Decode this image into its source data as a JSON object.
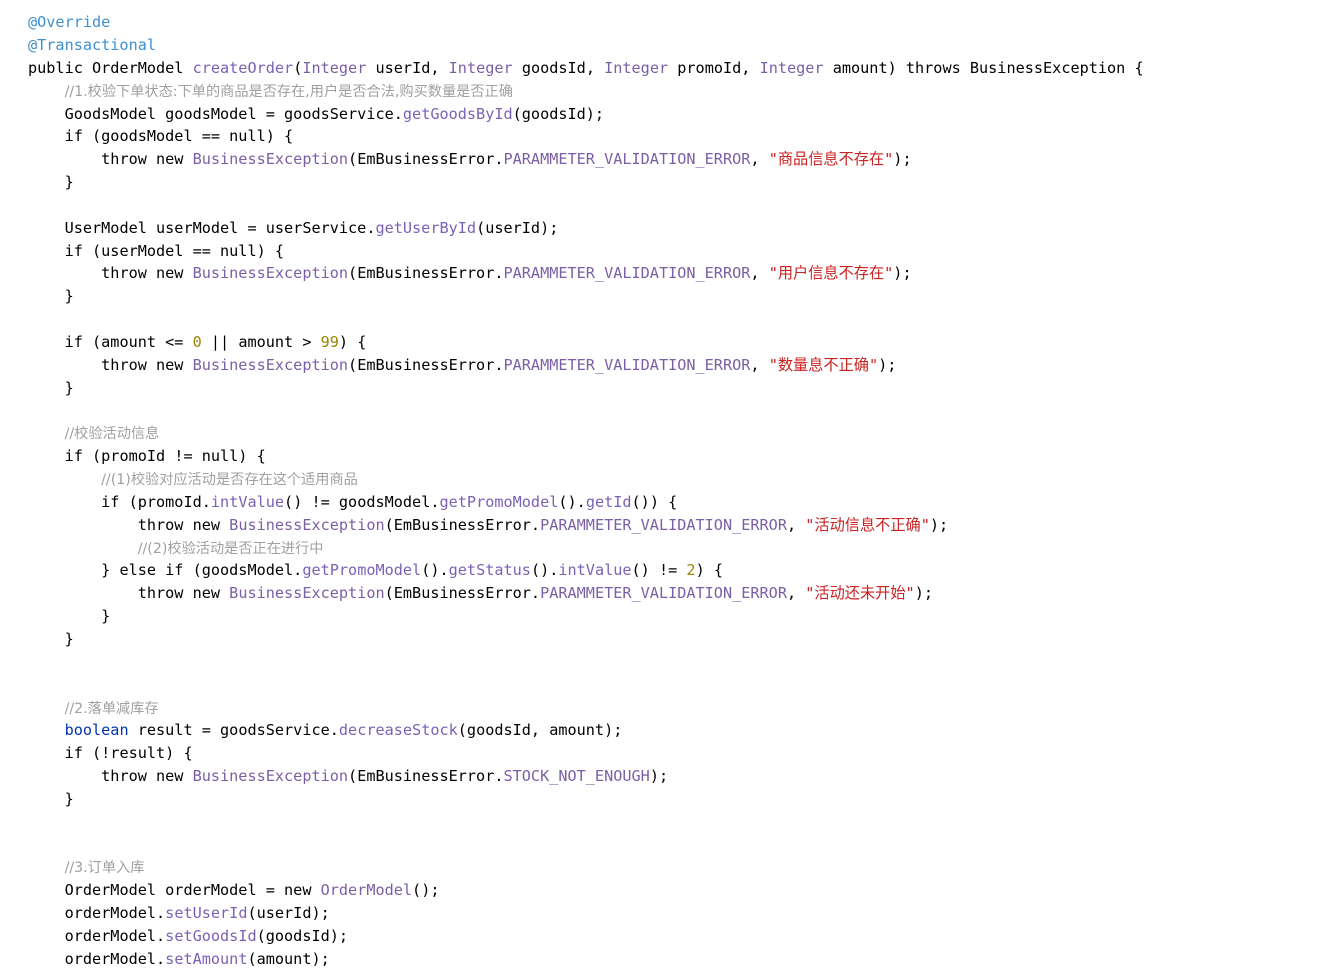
{
  "editor": {
    "language": "java",
    "background_color": "#ffffff",
    "default_text_color": "#000000",
    "font_size_px": 15,
    "line_height_px": 23,
    "visible_line_count": 41
  },
  "theme": {
    "annotation_color": "#3f8fcf",
    "keyword_color": "#0033b3",
    "class_type_color": "#7a5fa5",
    "method_call_color": "#7b61b5",
    "constant_color": "#7a5fa5",
    "string_color": "#cc2222",
    "number_color": "#9b8300",
    "comment_color": "#a0a0a0",
    "identifier_color": "#000000"
  },
  "code": {
    "lines": [
      {
        "n": 1,
        "indent": 0,
        "tokens": [
          {
            "t": "annotation",
            "v": "@Override"
          }
        ]
      },
      {
        "n": 2,
        "indent": 0,
        "tokens": [
          {
            "t": "annotation",
            "v": "@Transactional"
          }
        ]
      },
      {
        "n": 3,
        "indent": 0,
        "tokens": [
          {
            "t": "plain",
            "v": "public OrderModel "
          },
          {
            "t": "method",
            "v": "createOrder"
          },
          {
            "t": "plain",
            "v": "("
          },
          {
            "t": "type",
            "v": "Integer"
          },
          {
            "t": "plain",
            "v": " userId, "
          },
          {
            "t": "type",
            "v": "Integer"
          },
          {
            "t": "plain",
            "v": " goodsId, "
          },
          {
            "t": "type",
            "v": "Integer"
          },
          {
            "t": "plain",
            "v": " promoId, "
          },
          {
            "t": "type",
            "v": "Integer"
          },
          {
            "t": "plain",
            "v": " amount) throws BusinessException {"
          }
        ]
      },
      {
        "n": 4,
        "indent": 1,
        "tokens": [
          {
            "t": "comment",
            "v": "//1.校验下单状态:下单的商品是否存在,用户是否合法,购买数量是否正确"
          }
        ]
      },
      {
        "n": 5,
        "indent": 1,
        "tokens": [
          {
            "t": "plain",
            "v": "GoodsModel goodsModel = goodsService."
          },
          {
            "t": "method",
            "v": "getGoodsById"
          },
          {
            "t": "plain",
            "v": "(goodsId);"
          }
        ]
      },
      {
        "n": 6,
        "indent": 1,
        "tokens": [
          {
            "t": "plain",
            "v": "if (goodsModel == null) {"
          }
        ]
      },
      {
        "n": 7,
        "indent": 2,
        "tokens": [
          {
            "t": "plain",
            "v": "throw new "
          },
          {
            "t": "type",
            "v": "BusinessException"
          },
          {
            "t": "plain",
            "v": "(EmBusinessError."
          },
          {
            "t": "const",
            "v": "PARAMMETER_VALIDATION_ERROR"
          },
          {
            "t": "plain",
            "v": ", "
          },
          {
            "t": "string",
            "v": "\"商品信息不存在\""
          },
          {
            "t": "plain",
            "v": ");"
          }
        ]
      },
      {
        "n": 8,
        "indent": 1,
        "tokens": [
          {
            "t": "plain",
            "v": "}"
          }
        ]
      },
      {
        "n": 9,
        "indent": 0,
        "tokens": []
      },
      {
        "n": 10,
        "indent": 1,
        "tokens": [
          {
            "t": "plain",
            "v": "UserModel userModel = userService."
          },
          {
            "t": "method",
            "v": "getUserById"
          },
          {
            "t": "plain",
            "v": "(userId);"
          }
        ]
      },
      {
        "n": 11,
        "indent": 1,
        "tokens": [
          {
            "t": "plain",
            "v": "if (userModel == null) {"
          }
        ]
      },
      {
        "n": 12,
        "indent": 2,
        "tokens": [
          {
            "t": "plain",
            "v": "throw new "
          },
          {
            "t": "type",
            "v": "BusinessException"
          },
          {
            "t": "plain",
            "v": "(EmBusinessError."
          },
          {
            "t": "const",
            "v": "PARAMMETER_VALIDATION_ERROR"
          },
          {
            "t": "plain",
            "v": ", "
          },
          {
            "t": "string",
            "v": "\"用户信息不存在\""
          },
          {
            "t": "plain",
            "v": ");"
          }
        ]
      },
      {
        "n": 13,
        "indent": 1,
        "tokens": [
          {
            "t": "plain",
            "v": "}"
          }
        ]
      },
      {
        "n": 14,
        "indent": 0,
        "tokens": []
      },
      {
        "n": 15,
        "indent": 1,
        "tokens": [
          {
            "t": "plain",
            "v": "if (amount <= "
          },
          {
            "t": "number",
            "v": "0"
          },
          {
            "t": "plain",
            "v": " || amount > "
          },
          {
            "t": "number",
            "v": "99"
          },
          {
            "t": "plain",
            "v": ") {"
          }
        ]
      },
      {
        "n": 16,
        "indent": 2,
        "tokens": [
          {
            "t": "plain",
            "v": "throw new "
          },
          {
            "t": "type",
            "v": "BusinessException"
          },
          {
            "t": "plain",
            "v": "(EmBusinessError."
          },
          {
            "t": "const",
            "v": "PARAMMETER_VALIDATION_ERROR"
          },
          {
            "t": "plain",
            "v": ", "
          },
          {
            "t": "string",
            "v": "\"数量息不正确\""
          },
          {
            "t": "plain",
            "v": ");"
          }
        ]
      },
      {
        "n": 17,
        "indent": 1,
        "tokens": [
          {
            "t": "plain",
            "v": "}"
          }
        ]
      },
      {
        "n": 18,
        "indent": 0,
        "tokens": []
      },
      {
        "n": 19,
        "indent": 1,
        "tokens": [
          {
            "t": "comment",
            "v": "//校验活动信息"
          }
        ]
      },
      {
        "n": 20,
        "indent": 1,
        "tokens": [
          {
            "t": "plain",
            "v": "if (promoId != null) {"
          }
        ]
      },
      {
        "n": 21,
        "indent": 2,
        "tokens": [
          {
            "t": "comment",
            "v": "//(1)校验对应活动是否存在这个适用商品"
          }
        ]
      },
      {
        "n": 22,
        "indent": 2,
        "tokens": [
          {
            "t": "plain",
            "v": "if (promoId."
          },
          {
            "t": "method",
            "v": "intValue"
          },
          {
            "t": "plain",
            "v": "() != goodsModel."
          },
          {
            "t": "method",
            "v": "getPromoModel"
          },
          {
            "t": "plain",
            "v": "()."
          },
          {
            "t": "method",
            "v": "getId"
          },
          {
            "t": "plain",
            "v": "()) {"
          }
        ]
      },
      {
        "n": 23,
        "indent": 3,
        "tokens": [
          {
            "t": "plain",
            "v": "throw new "
          },
          {
            "t": "type",
            "v": "BusinessException"
          },
          {
            "t": "plain",
            "v": "(EmBusinessError."
          },
          {
            "t": "const",
            "v": "PARAMMETER_VALIDATION_ERROR"
          },
          {
            "t": "plain",
            "v": ", "
          },
          {
            "t": "string",
            "v": "\"活动信息不正确\""
          },
          {
            "t": "plain",
            "v": ");"
          }
        ]
      },
      {
        "n": 24,
        "indent": 3,
        "tokens": [
          {
            "t": "comment",
            "v": "//(2)校验活动是否正在进行中"
          }
        ]
      },
      {
        "n": 25,
        "indent": 2,
        "tokens": [
          {
            "t": "plain",
            "v": "} else if (goodsModel."
          },
          {
            "t": "method",
            "v": "getPromoModel"
          },
          {
            "t": "plain",
            "v": "()."
          },
          {
            "t": "method",
            "v": "getStatus"
          },
          {
            "t": "plain",
            "v": "()."
          },
          {
            "t": "method",
            "v": "intValue"
          },
          {
            "t": "plain",
            "v": "() != "
          },
          {
            "t": "number",
            "v": "2"
          },
          {
            "t": "plain",
            "v": ") {"
          }
        ]
      },
      {
        "n": 26,
        "indent": 3,
        "tokens": [
          {
            "t": "plain",
            "v": "throw new "
          },
          {
            "t": "type",
            "v": "BusinessException"
          },
          {
            "t": "plain",
            "v": "(EmBusinessError."
          },
          {
            "t": "const",
            "v": "PARAMMETER_VALIDATION_ERROR"
          },
          {
            "t": "plain",
            "v": ", "
          },
          {
            "t": "string",
            "v": "\"活动还未开始\""
          },
          {
            "t": "plain",
            "v": ");"
          }
        ]
      },
      {
        "n": 27,
        "indent": 2,
        "tokens": [
          {
            "t": "plain",
            "v": "}"
          }
        ]
      },
      {
        "n": 28,
        "indent": 1,
        "tokens": [
          {
            "t": "plain",
            "v": "}"
          }
        ]
      },
      {
        "n": 29,
        "indent": 0,
        "tokens": []
      },
      {
        "n": 30,
        "indent": 0,
        "tokens": []
      },
      {
        "n": 31,
        "indent": 1,
        "tokens": [
          {
            "t": "comment",
            "v": "//2.落单减库存"
          }
        ]
      },
      {
        "n": 32,
        "indent": 1,
        "tokens": [
          {
            "t": "keyword",
            "v": "boolean"
          },
          {
            "t": "plain",
            "v": " result = goodsService."
          },
          {
            "t": "method",
            "v": "decreaseStock"
          },
          {
            "t": "plain",
            "v": "(goodsId, amount);"
          }
        ]
      },
      {
        "n": 33,
        "indent": 1,
        "tokens": [
          {
            "t": "plain",
            "v": "if (!result) {"
          }
        ]
      },
      {
        "n": 34,
        "indent": 2,
        "tokens": [
          {
            "t": "plain",
            "v": "throw new "
          },
          {
            "t": "type",
            "v": "BusinessException"
          },
          {
            "t": "plain",
            "v": "(EmBusinessError."
          },
          {
            "t": "const",
            "v": "STOCK_NOT_ENOUGH"
          },
          {
            "t": "plain",
            "v": ");"
          }
        ]
      },
      {
        "n": 35,
        "indent": 1,
        "tokens": [
          {
            "t": "plain",
            "v": "}"
          }
        ]
      },
      {
        "n": 36,
        "indent": 0,
        "tokens": []
      },
      {
        "n": 37,
        "indent": 0,
        "tokens": []
      },
      {
        "n": 38,
        "indent": 1,
        "tokens": [
          {
            "t": "comment",
            "v": "//3.订单入库"
          }
        ]
      },
      {
        "n": 39,
        "indent": 1,
        "tokens": [
          {
            "t": "plain",
            "v": "OrderModel orderModel = new "
          },
          {
            "t": "type",
            "v": "OrderModel"
          },
          {
            "t": "plain",
            "v": "();"
          }
        ]
      },
      {
        "n": 40,
        "indent": 1,
        "tokens": [
          {
            "t": "plain",
            "v": "orderModel."
          },
          {
            "t": "method",
            "v": "setUserId"
          },
          {
            "t": "plain",
            "v": "(userId);"
          }
        ]
      },
      {
        "n": 41,
        "indent": 1,
        "tokens": [
          {
            "t": "plain",
            "v": "orderModel."
          },
          {
            "t": "method",
            "v": "setGoodsId"
          },
          {
            "t": "plain",
            "v": "(goodsId);"
          }
        ]
      },
      {
        "n": 42,
        "indent": 1,
        "tokens": [
          {
            "t": "plain",
            "v": "orderModel."
          },
          {
            "t": "method",
            "v": "setAmount"
          },
          {
            "t": "plain",
            "v": "(amount);"
          }
        ]
      }
    ]
  }
}
